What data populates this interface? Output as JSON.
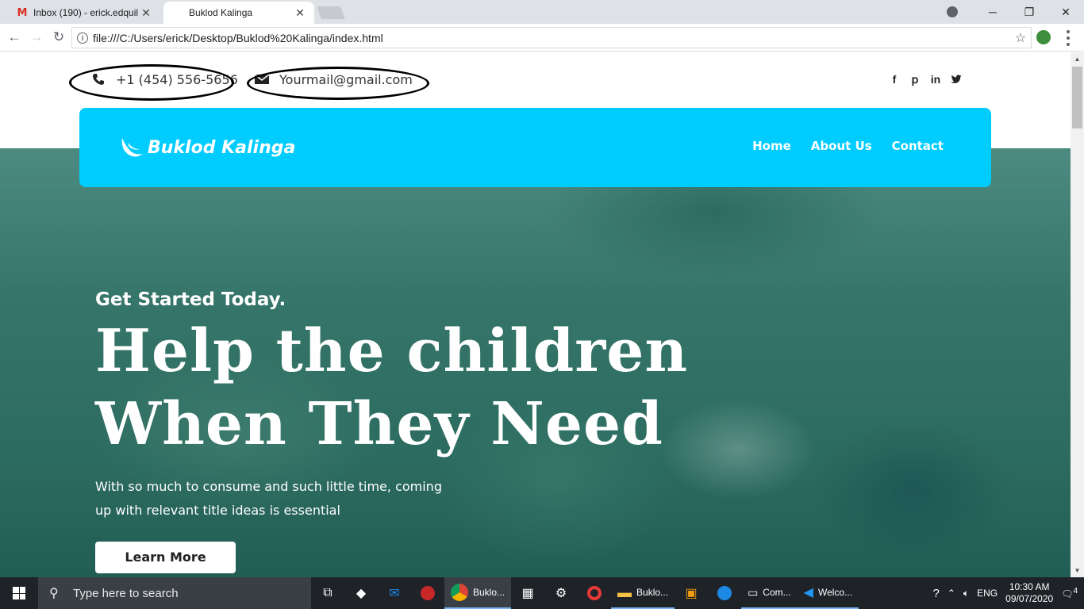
{
  "browser": {
    "tabs": [
      {
        "title": "Inbox (190) - erick.edquil",
        "icon": "gmail-icon",
        "active": false
      },
      {
        "title": "Buklod Kalinga",
        "icon": "page-icon",
        "active": true
      }
    ],
    "url": "file:///C:/Users/erick/Desktop/Buklod%20Kalinga/index.html"
  },
  "site": {
    "topbar": {
      "phone": "+1 (454) 556-5656",
      "email": "Yourmail@gmail.com",
      "socials": [
        "facebook-icon",
        "pinterest-icon",
        "linkedin-icon",
        "twitter-icon"
      ]
    },
    "brand": {
      "name": "Buklod Kalinga"
    },
    "nav": [
      "Home",
      "About Us",
      "Contact"
    ],
    "hero": {
      "kicker": "Get Started Today.",
      "title_line1": "Help the children",
      "title_line2": "When They Need",
      "text": "With so much to consume and such little time, coming up with relevant title ideas is essential",
      "button": "Learn More"
    },
    "colors": {
      "navbar": "#00ccff",
      "hero_overlay": "#3f7468"
    }
  },
  "taskbar": {
    "search_placeholder": "Type here to search",
    "apps": [
      {
        "label": "Buklo...",
        "icon": "chrome-icon",
        "active": true
      },
      {
        "label": "Buklo...",
        "icon": "folder-icon",
        "active": false
      },
      {
        "label": "Com...",
        "icon": "terminal-icon",
        "active": false
      },
      {
        "label": "Welco...",
        "icon": "vscode-icon",
        "active": false
      }
    ],
    "lang": "ENG",
    "time": "10:30 AM",
    "date": "09/07/2020",
    "notifications": "4"
  }
}
